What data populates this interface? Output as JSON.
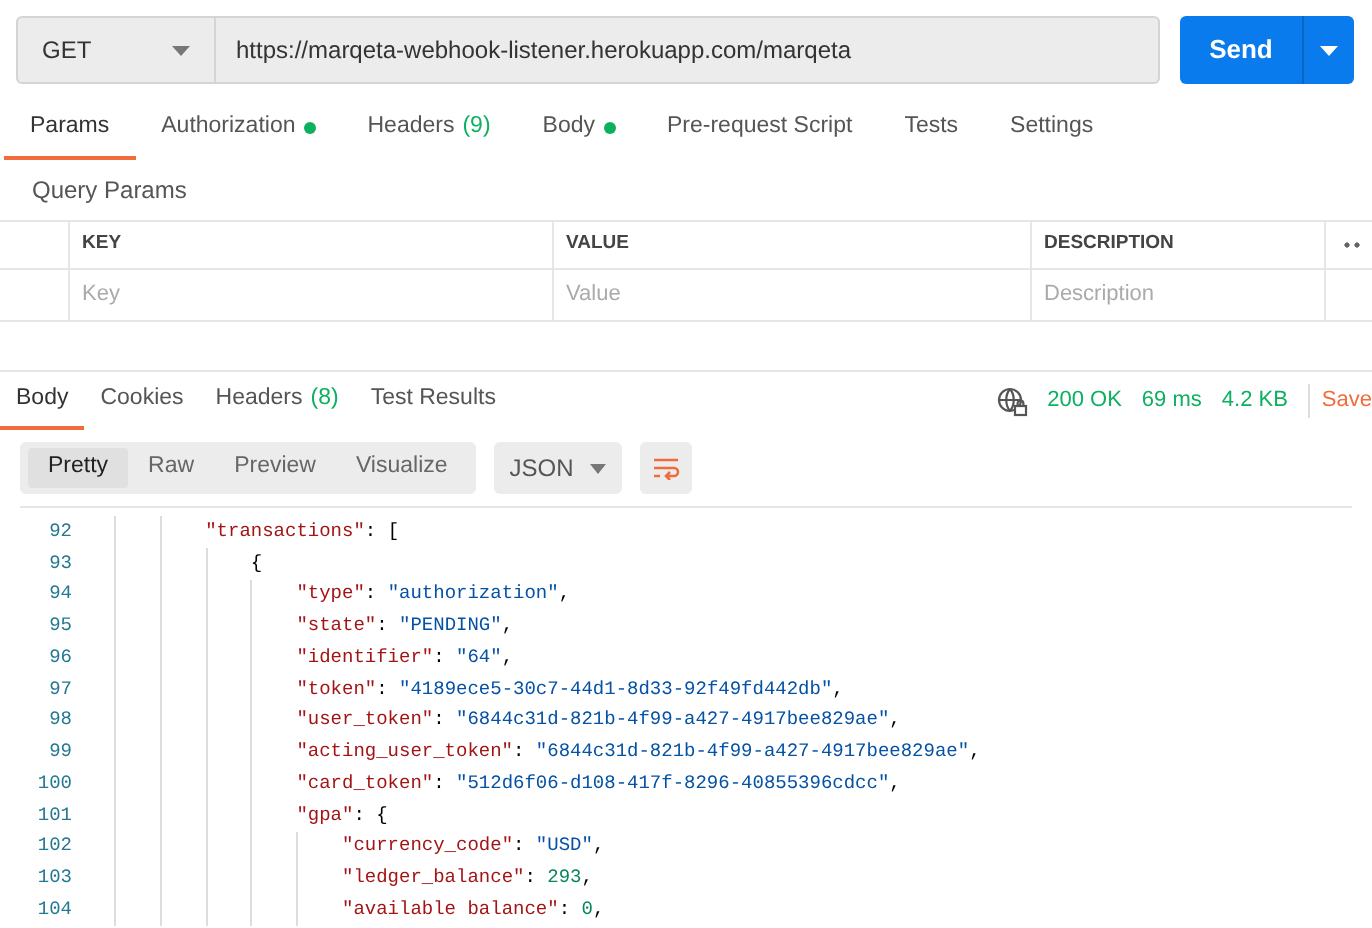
{
  "request": {
    "method": "GET",
    "url": "https://marqeta-webhook-listener.herokuapp.com/marqeta",
    "send_label": "Send"
  },
  "request_tabs": [
    {
      "label": "Params",
      "selected": true,
      "dot": false
    },
    {
      "label": "Authorization",
      "selected": false,
      "dot": true
    },
    {
      "label": "Headers",
      "count": "(9)",
      "selected": false,
      "dot": false
    },
    {
      "label": "Body",
      "selected": false,
      "dot": true
    },
    {
      "label": "Pre-request Script",
      "selected": false,
      "dot": false
    },
    {
      "label": "Tests",
      "selected": false,
      "dot": false
    },
    {
      "label": "Settings",
      "selected": false,
      "dot": false
    }
  ],
  "query_params": {
    "title": "Query Params",
    "columns": [
      "KEY",
      "VALUE",
      "DESCRIPTION"
    ],
    "placeholders": [
      "Key",
      "Value",
      "Description"
    ]
  },
  "response_tabs": [
    {
      "label": "Body",
      "selected": true
    },
    {
      "label": "Cookies",
      "selected": false
    },
    {
      "label": "Headers",
      "count": "(8)",
      "selected": false
    },
    {
      "label": "Test Results",
      "selected": false
    }
  ],
  "response_status": {
    "code": "200 OK",
    "time": "69 ms",
    "size": "4.2 KB",
    "save_label": "Save"
  },
  "view_modes": [
    {
      "label": "Pretty",
      "selected": true
    },
    {
      "label": "Raw",
      "selected": false
    },
    {
      "label": "Preview",
      "selected": false
    },
    {
      "label": "Visualize",
      "selected": false
    }
  ],
  "format": "JSON",
  "code_lines": [
    {
      "number": "92",
      "tokens": [
        {
          "kind": "key",
          "text": "\"transactions\""
        },
        {
          "kind": "punct",
          "text": ": ["
        }
      ],
      "children": [
        {
          "number": "93",
          "tokens": [
            {
              "kind": "punct",
              "text": "{"
            }
          ],
          "children": [
            {
              "number": "94",
              "tokens": [
                {
                  "kind": "key",
                  "text": "\"type\""
                },
                {
                  "kind": "punct",
                  "text": ": "
                },
                {
                  "kind": "string",
                  "text": "\"authorization\""
                },
                {
                  "kind": "punct",
                  "text": ","
                }
              ]
            },
            {
              "number": "95",
              "tokens": [
                {
                  "kind": "key",
                  "text": "\"state\""
                },
                {
                  "kind": "punct",
                  "text": ": "
                },
                {
                  "kind": "string",
                  "text": "\"PENDING\""
                },
                {
                  "kind": "punct",
                  "text": ","
                }
              ]
            },
            {
              "number": "96",
              "tokens": [
                {
                  "kind": "key",
                  "text": "\"identifier\""
                },
                {
                  "kind": "punct",
                  "text": ": "
                },
                {
                  "kind": "string",
                  "text": "\"64\""
                },
                {
                  "kind": "punct",
                  "text": ","
                }
              ]
            },
            {
              "number": "97",
              "tokens": [
                {
                  "kind": "key",
                  "text": "\"token\""
                },
                {
                  "kind": "punct",
                  "text": ": "
                },
                {
                  "kind": "string",
                  "text": "\"4189ece5-30c7-44d1-8d33-92f49fd442db\""
                },
                {
                  "kind": "punct",
                  "text": ","
                }
              ]
            },
            {
              "number": "98",
              "tokens": [
                {
                  "kind": "key",
                  "text": "\"user_token\""
                },
                {
                  "kind": "punct",
                  "text": ": "
                },
                {
                  "kind": "string",
                  "text": "\"6844c31d-821b-4f99-a427-4917bee829ae\""
                },
                {
                  "kind": "punct",
                  "text": ","
                }
              ]
            },
            {
              "number": "99",
              "tokens": [
                {
                  "kind": "key",
                  "text": "\"acting_user_token\""
                },
                {
                  "kind": "punct",
                  "text": ": "
                },
                {
                  "kind": "string",
                  "text": "\"6844c31d-821b-4f99-a427-4917bee829ae\""
                },
                {
                  "kind": "punct",
                  "text": ","
                }
              ]
            },
            {
              "number": "100",
              "tokens": [
                {
                  "kind": "key",
                  "text": "\"card_token\""
                },
                {
                  "kind": "punct",
                  "text": ": "
                },
                {
                  "kind": "string",
                  "text": "\"512d6f06-d108-417f-8296-40855396cdcc\""
                },
                {
                  "kind": "punct",
                  "text": ","
                }
              ]
            },
            {
              "number": "101",
              "tokens": [
                {
                  "kind": "key",
                  "text": "\"gpa\""
                },
                {
                  "kind": "punct",
                  "text": ": {"
                }
              ],
              "children": [
                {
                  "number": "102",
                  "tokens": [
                    {
                      "kind": "key",
                      "text": "\"currency_code\""
                    },
                    {
                      "kind": "punct",
                      "text": ": "
                    },
                    {
                      "kind": "string",
                      "text": "\"USD\""
                    },
                    {
                      "kind": "punct",
                      "text": ","
                    }
                  ]
                },
                {
                  "number": "103",
                  "tokens": [
                    {
                      "kind": "key",
                      "text": "\"ledger_balance\""
                    },
                    {
                      "kind": "punct",
                      "text": ": "
                    },
                    {
                      "kind": "number",
                      "text": "293"
                    },
                    {
                      "kind": "punct",
                      "text": ","
                    }
                  ]
                },
                {
                  "number": "104",
                  "tokens": [
                    {
                      "kind": "key",
                      "text": "\"available balance\""
                    },
                    {
                      "kind": "punct",
                      "text": ": "
                    },
                    {
                      "kind": "number",
                      "text": "0"
                    },
                    {
                      "kind": "punct",
                      "text": ","
                    }
                  ]
                }
              ]
            }
          ]
        }
      ]
    }
  ]
}
